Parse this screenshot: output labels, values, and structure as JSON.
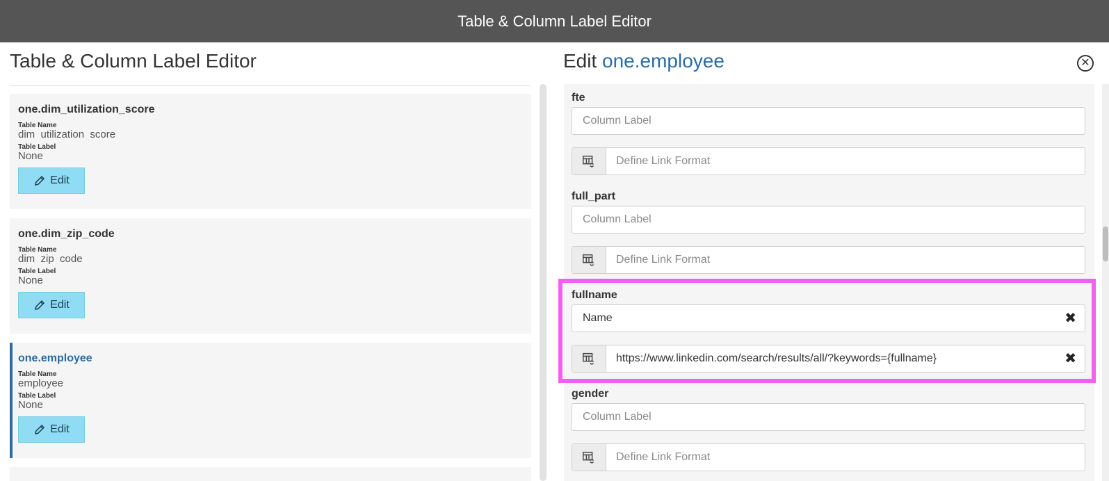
{
  "window": {
    "title": "Table & Column Label Editor"
  },
  "left_panel": {
    "heading": "Table & Column Label Editor",
    "cards": [
      {
        "title": "one.dim_utilization_score",
        "table_name_caption": "Table Name",
        "table_name": "dim  utilization  score",
        "table_label_caption": "Table Label",
        "table_label": "None",
        "edit_label": "Edit"
      },
      {
        "title": "one.dim_zip_code",
        "table_name_caption": "Table Name",
        "table_name": "dim  zip  code",
        "table_label_caption": "Table Label",
        "table_label": "None",
        "edit_label": "Edit"
      },
      {
        "title": "one.employee",
        "table_name_caption": "Table Name",
        "table_name": "employee",
        "table_label_caption": "Table Label",
        "table_label": "None",
        "edit_label": "Edit",
        "active": true
      }
    ]
  },
  "right_panel": {
    "heading_prefix": "Edit",
    "heading_table": "one.employee",
    "columns": [
      {
        "name": "fte",
        "label_value": "",
        "label_placeholder": "Column Label",
        "link_value": "",
        "link_placeholder": "Define Link Format"
      },
      {
        "name": "full_part",
        "label_value": "",
        "label_placeholder": "Column Label",
        "link_value": "",
        "link_placeholder": "Define Link Format"
      },
      {
        "name": "fullname",
        "label_value": "Name",
        "label_placeholder": "Column Label",
        "link_value": "https://www.linkedin.com/search/results/all/?keywords={fullname}",
        "link_placeholder": "Define Link Format",
        "highlighted": true
      },
      {
        "name": "gender",
        "label_value": "",
        "label_placeholder": "Column Label",
        "link_value": "",
        "link_placeholder": "Define Link Format"
      }
    ]
  },
  "colors": {
    "accent": "#2b6ca3",
    "edit_button": "#8fdcf4",
    "highlight": "#f25ff2",
    "titlebar": "#555555"
  },
  "icons": {
    "close": "close-circle-icon",
    "edit": "pencil-icon",
    "link_format": "table-link-icon",
    "clear": "clear-x-icon"
  }
}
